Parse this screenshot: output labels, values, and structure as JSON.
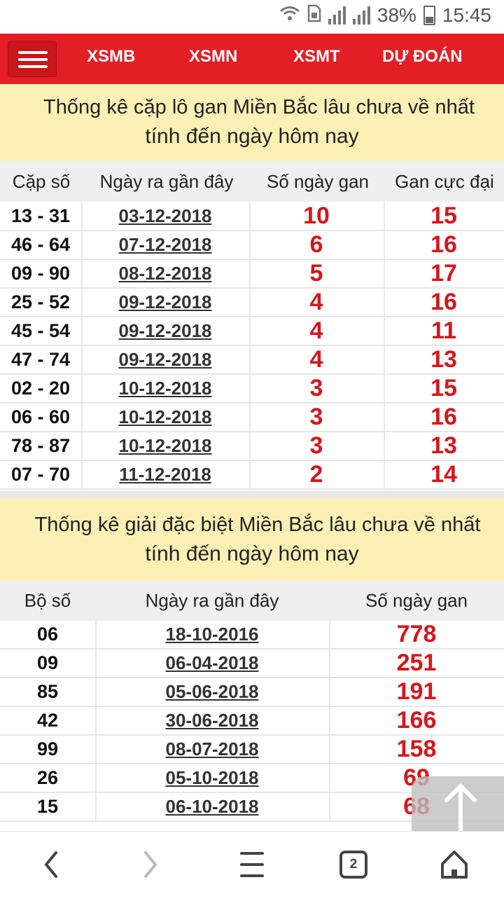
{
  "status": {
    "battery": "38%",
    "time": "15:45"
  },
  "nav": {
    "items": [
      "XSMB",
      "XSMN",
      "XSMT",
      "DỰ ĐOÁN"
    ]
  },
  "section1": {
    "title_line1": "Thống kê cặp lô gan Miền Bắc lâu chưa về nhất",
    "title_line2": "tính đến ngày hôm nay",
    "headers": [
      "Cặp số",
      "Ngày ra gần đây",
      "Số ngày gan",
      "Gan cực đại"
    ],
    "rows": [
      {
        "pair": "13 - 31",
        "date": "03-12-2018",
        "days": "10",
        "max": "15"
      },
      {
        "pair": "46 - 64",
        "date": "07-12-2018",
        "days": "6",
        "max": "16"
      },
      {
        "pair": "09 - 90",
        "date": "08-12-2018",
        "days": "5",
        "max": "17"
      },
      {
        "pair": "25 - 52",
        "date": "09-12-2018",
        "days": "4",
        "max": "16"
      },
      {
        "pair": "45 - 54",
        "date": "09-12-2018",
        "days": "4",
        "max": "11"
      },
      {
        "pair": "47 - 74",
        "date": "09-12-2018",
        "days": "4",
        "max": "13"
      },
      {
        "pair": "02 - 20",
        "date": "10-12-2018",
        "days": "3",
        "max": "15"
      },
      {
        "pair": "06 - 60",
        "date": "10-12-2018",
        "days": "3",
        "max": "16"
      },
      {
        "pair": "78 - 87",
        "date": "10-12-2018",
        "days": "3",
        "max": "13"
      },
      {
        "pair": "07 - 70",
        "date": "11-12-2018",
        "days": "2",
        "max": "14"
      }
    ]
  },
  "section2": {
    "title_line1": "Thống kê giải đặc biệt Miền Bắc lâu chưa về nhất",
    "title_line2": "tính đến ngày hôm nay",
    "headers": [
      "Bộ số",
      "Ngày ra gần đây",
      "Số ngày gan"
    ],
    "rows": [
      {
        "num": "06",
        "date": "18-10-2016",
        "days": "778"
      },
      {
        "num": "09",
        "date": "06-04-2018",
        "days": "251"
      },
      {
        "num": "85",
        "date": "05-06-2018",
        "days": "191"
      },
      {
        "num": "42",
        "date": "30-06-2018",
        "days": "166"
      },
      {
        "num": "99",
        "date": "08-07-2018",
        "days": "158"
      },
      {
        "num": "26",
        "date": "05-10-2018",
        "days": "69"
      },
      {
        "num": "15",
        "date": "06-10-2018",
        "days": "68"
      }
    ]
  },
  "bottom_bar": {
    "tab_count": "2"
  },
  "icons": {
    "wifi": "wifi-call-icon",
    "sim": "sim-icon",
    "menu": "hamburger-icon",
    "back": "back-arrow-icon",
    "forward": "forward-arrow-icon",
    "browser_menu": "browser-menu-icon",
    "tabs": "tabs-icon",
    "home": "home-icon",
    "to_top": "arrow-up-icon"
  },
  "colors": {
    "brand_red": "#e41e25",
    "header_yellow": "#fcf0b5",
    "value_red": "#d5161c"
  }
}
